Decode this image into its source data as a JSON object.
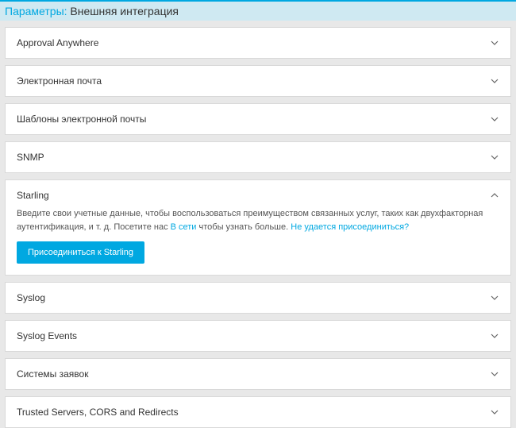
{
  "header": {
    "prefix": "Параметры:",
    "title": "Внешняя интеграция"
  },
  "panels": {
    "approval": {
      "title": "Approval Anywhere"
    },
    "email": {
      "title": "Электронная почта"
    },
    "templates": {
      "title": "Шаблоны электронной почты"
    },
    "snmp": {
      "title": "SNMP"
    },
    "starling": {
      "title": "Starling",
      "body_part1": "Введите свои учетные данные, чтобы воспользоваться преимуществом связанных услуг, таких как двухфакторная аутентификация, и т. д. Посетите нас ",
      "link1": "В сети",
      "body_part2": " чтобы узнать больше. ",
      "link2": "Не удается присоединиться?",
      "button": "Присоединиться к Starling"
    },
    "syslog": {
      "title": "Syslog"
    },
    "syslog_events": {
      "title": "Syslog Events"
    },
    "ticket": {
      "title": "Системы заявок"
    },
    "trusted": {
      "title": "Trusted Servers, CORS and Redirects"
    }
  }
}
